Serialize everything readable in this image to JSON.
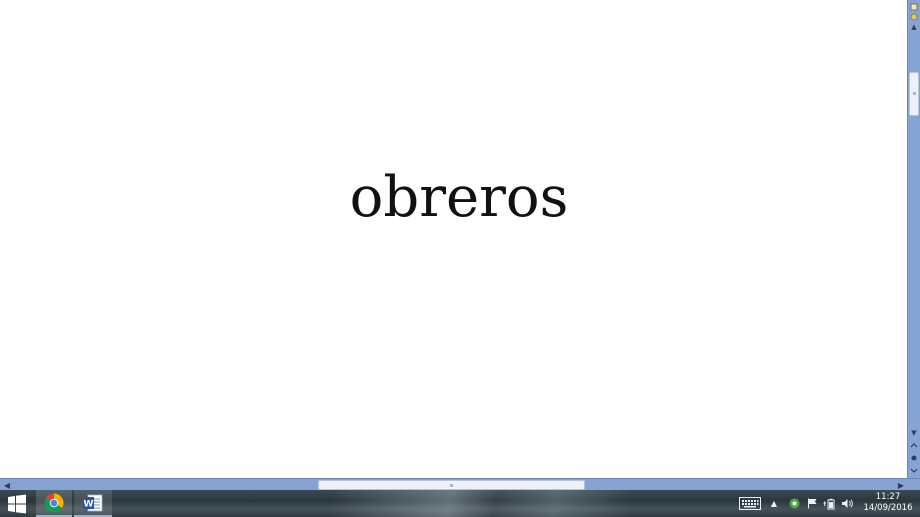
{
  "document": {
    "word": "obreros"
  },
  "taskbar": {
    "start_icon": "windows-logo-icon",
    "apps": [
      {
        "name": "chrome",
        "icon": "chrome-icon"
      },
      {
        "name": "word",
        "icon": "word-icon",
        "letter": "W"
      }
    ],
    "tray": {
      "keyboard_icon": "keyboard-icon",
      "chevron": "▲",
      "clock_time": "11:27",
      "clock_date": "14/09/2016"
    }
  },
  "scrollbars": {
    "vertical": {
      "up": "▲",
      "down": "▼"
    },
    "horizontal": {
      "left": "◀",
      "right": "▶"
    }
  },
  "colors": {
    "scrollbar": "#86a4d3",
    "taskbar": "#2b363c",
    "text": "#111111"
  }
}
